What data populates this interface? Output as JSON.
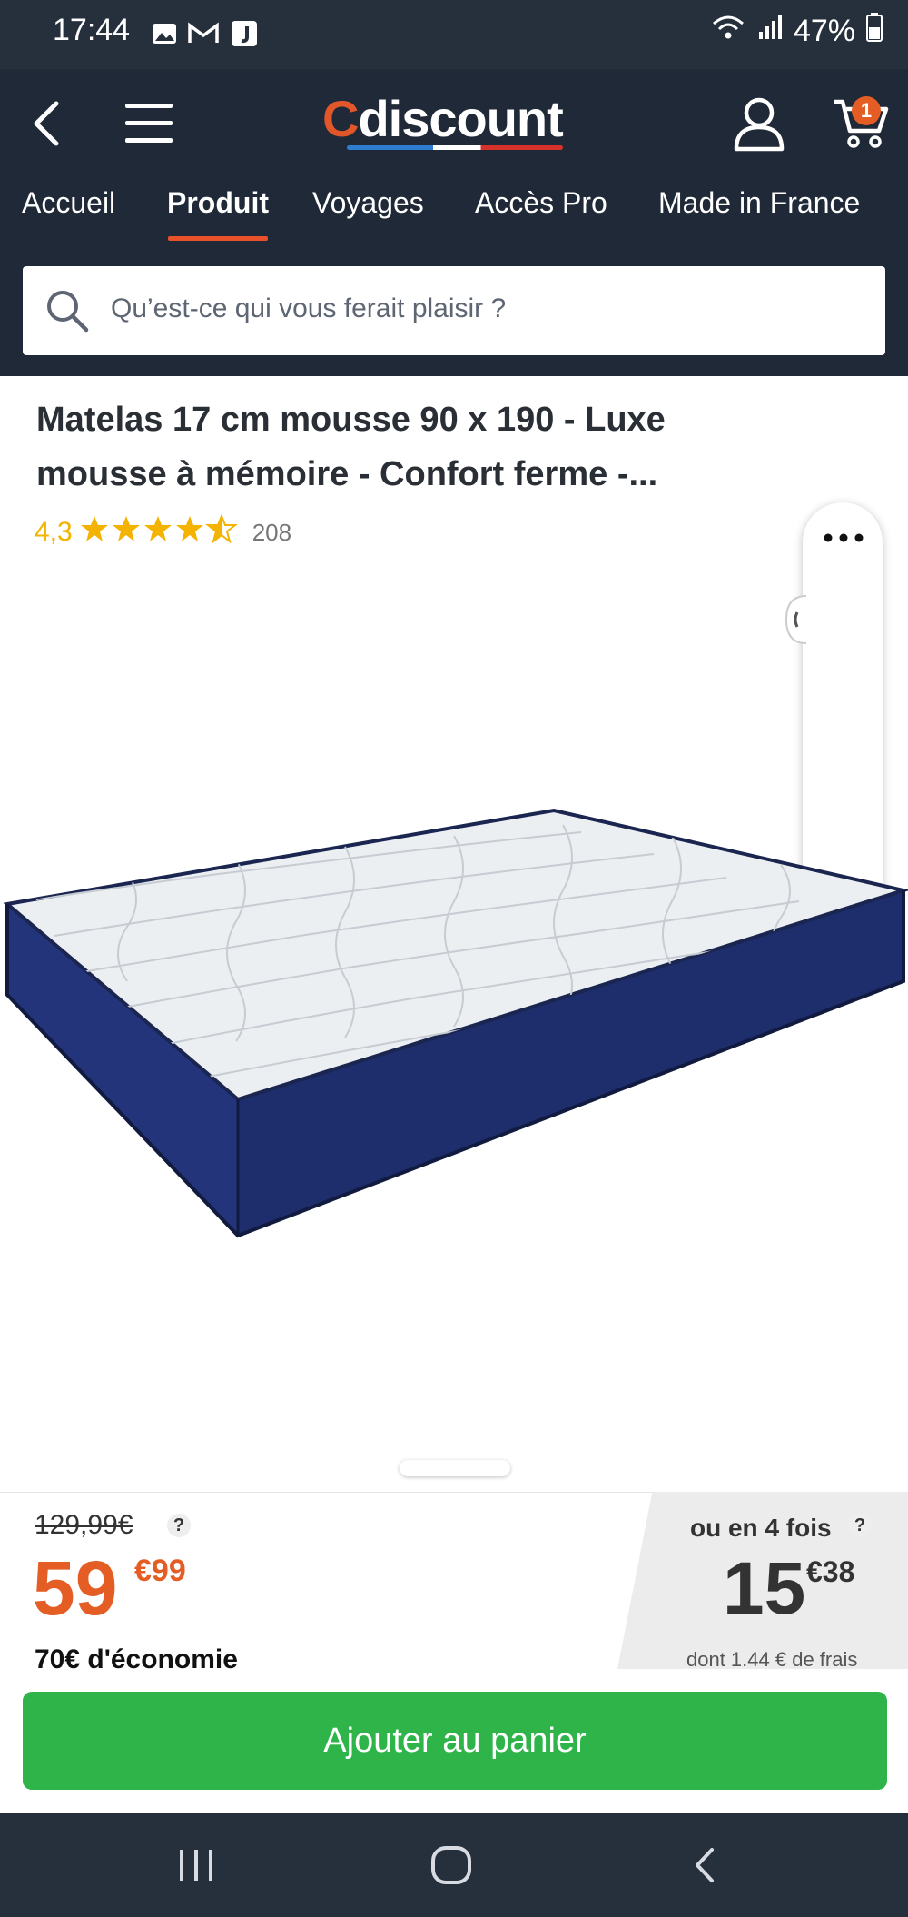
{
  "status_bar": {
    "time": "17:44",
    "notification_icons": [
      "gallery-icon",
      "gmail-icon",
      "app-j-icon"
    ],
    "battery_percent": "47%"
  },
  "header": {
    "logo_prefix": "C",
    "logo_rest": "discount",
    "cart_count": "1",
    "tabs": [
      {
        "label": "Accueil",
        "active": false
      },
      {
        "label": "Produit",
        "active": true
      },
      {
        "label": "Voyages",
        "active": false
      },
      {
        "label": "Accès Pro",
        "active": false
      },
      {
        "label": "Made in France",
        "active": false
      }
    ],
    "search_placeholder": "Qu’est-ce qui vous ferait plaisir ?"
  },
  "product": {
    "title_line1": "Matelas 17 cm mousse 90 x 190 - Luxe",
    "title_line2": "mousse à mémoire - Confort ferme -...",
    "rating_value": "4,3",
    "rating_stars": 4.3,
    "review_count": "208"
  },
  "pricing": {
    "old_price": "129,99€",
    "help_mark": "?",
    "price_main": "59",
    "price_cents": "€99",
    "saving": "70€ d'économie",
    "installment_label": "ou en 4 fois",
    "installment_main": "15",
    "installment_cents": "€38",
    "installment_fee": "dont 1.44 € de frais"
  },
  "actions": {
    "add_to_cart": "Ajouter au panier"
  },
  "colors": {
    "header_bg": "#1f2937",
    "accent_orange": "#e45d24",
    "cta_green": "#2fb44a",
    "star_yellow": "#f3b300"
  }
}
